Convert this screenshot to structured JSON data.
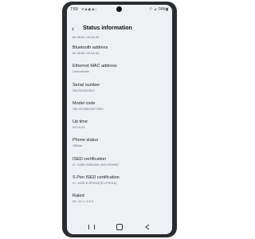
{
  "status_bar": {
    "time": "7:59",
    "icons": "⚙ ◙ ▣ ◉ •",
    "right": "⌔ ⊿ 74%▮"
  },
  "header": {
    "back_glyph": "‹",
    "title": "Status information"
  },
  "items": [
    {
      "label": "",
      "value": "80:35:8C:1E:82:4E"
    },
    {
      "label": "Bluetooth address",
      "value": "80:35:8C:1E:82:4D"
    },
    {
      "label": "Ethernet MAC address",
      "value": "Unavailable"
    },
    {
      "label": "Serial number",
      "value": "R5CW13NJ94Y"
    },
    {
      "label": "Model code",
      "value": "SM-S918W/ZMYVMC"
    },
    {
      "label": "Up time",
      "value": "00:10:31"
    },
    {
      "label": "Phone status",
      "value": "Official"
    },
    {
      "label": "ISED certification",
      "value": "IC: 649E-SM918W (SM-S918W)"
    },
    {
      "label": "S Pen ISED certification",
      "value": "IC: 649E-EJPS918 (EJ-PS918)"
    },
    {
      "label": "Rated",
      "value": "DC 10 V, 4.5 A"
    }
  ]
}
